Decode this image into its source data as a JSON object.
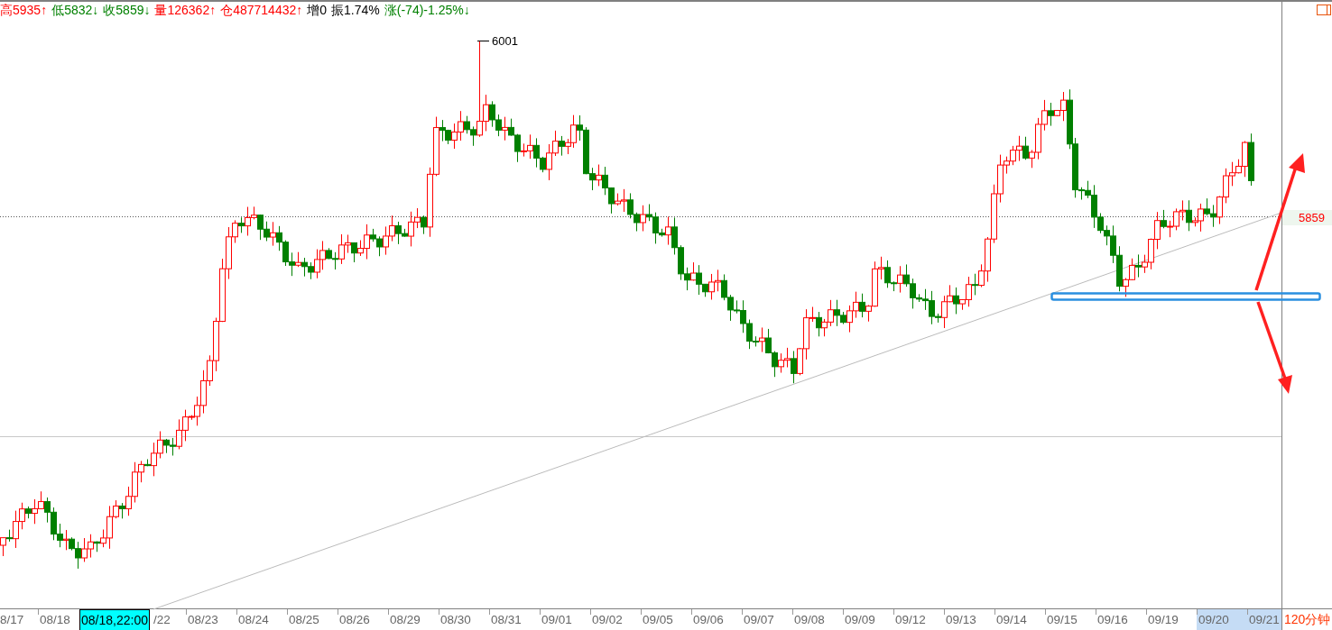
{
  "quote_bar": [
    {
      "text": "高5935↑",
      "color": "#ff0000"
    },
    {
      "text": "低5832↓",
      "color": "#008000"
    },
    {
      "text": "收5859↓",
      "color": "#008000"
    },
    {
      "text": "量126362↑",
      "color": "#ff0000"
    },
    {
      "text": "仓487714432↑",
      "color": "#ff0000"
    },
    {
      "text": "增0",
      "color": "#000000"
    },
    {
      "text": "振1.74%",
      "color": "#000000"
    },
    {
      "text": "涨(-74)-1.25%↓",
      "color": "#008000"
    }
  ],
  "chart": {
    "high_label": "6001",
    "price_tag": "5859",
    "cursor_time": "08/18,22:00",
    "period": "120分钟"
  },
  "time_axis": [
    {
      "label": "8/17",
      "highlighted": false
    },
    {
      "label": "08/18",
      "highlighted": false
    },
    {
      "label": "/22",
      "highlighted": false
    },
    {
      "label": "08/23",
      "highlighted": false
    },
    {
      "label": "08/24",
      "highlighted": false
    },
    {
      "label": "08/25",
      "highlighted": false
    },
    {
      "label": "08/26",
      "highlighted": false
    },
    {
      "label": "08/29",
      "highlighted": false
    },
    {
      "label": "08/30",
      "highlighted": false
    },
    {
      "label": "08/31",
      "highlighted": false
    },
    {
      "label": "09/01",
      "highlighted": false
    },
    {
      "label": "09/02",
      "highlighted": false
    },
    {
      "label": "09/05",
      "highlighted": false
    },
    {
      "label": "09/06",
      "highlighted": false
    },
    {
      "label": "09/07",
      "highlighted": false
    },
    {
      "label": "09/08",
      "highlighted": false
    },
    {
      "label": "09/09",
      "highlighted": false
    },
    {
      "label": "09/12",
      "highlighted": false
    },
    {
      "label": "09/13",
      "highlighted": false
    },
    {
      "label": "09/14",
      "highlighted": false
    },
    {
      "label": "09/15",
      "highlighted": false
    },
    {
      "label": "09/16",
      "highlighted": false
    },
    {
      "label": "09/19",
      "highlighted": false
    },
    {
      "label": "09/20",
      "highlighted": true
    },
    {
      "label": "09/21",
      "highlighted": true
    }
  ]
}
